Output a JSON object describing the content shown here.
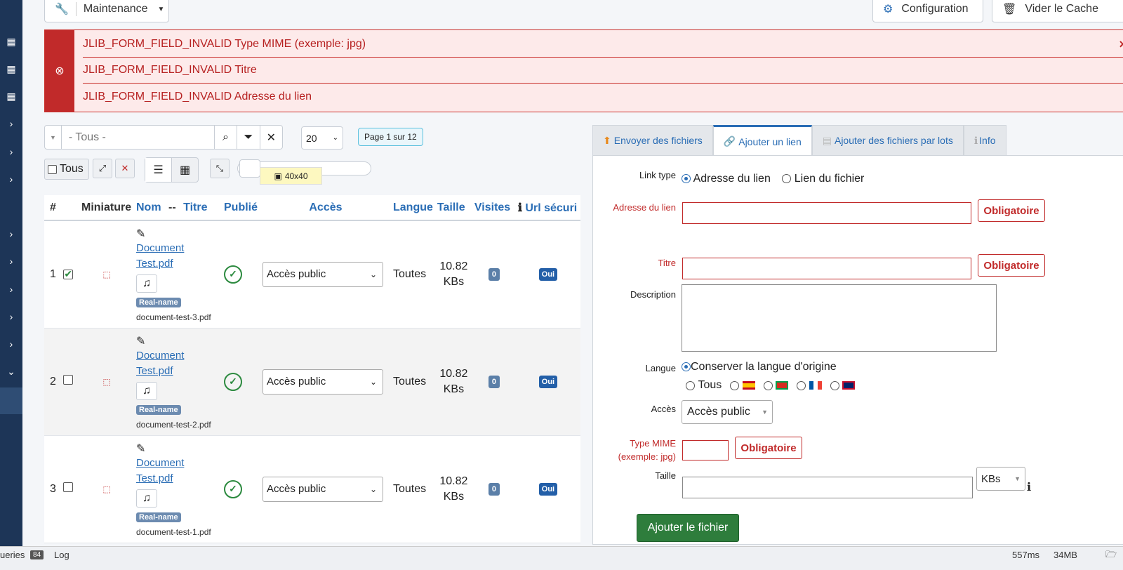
{
  "topbar": {
    "maintenance_label": "Maintenance",
    "configuration_label": "Configuration",
    "vider_label": "Vider le Cache"
  },
  "alert": {
    "messages": [
      "JLIB_FORM_FIELD_INVALID Type MIME (exemple: jpg)",
      "JLIB_FORM_FIELD_INVALID Titre",
      "JLIB_FORM_FIELD_INVALID Adresse du lien"
    ],
    "close": "×"
  },
  "filters": {
    "search_placeholder": "- Tous -",
    "limit": "20",
    "page_info": "Page 1 sur 12",
    "tous_label": "Tous",
    "thumb_size": "40x40"
  },
  "table": {
    "headers": {
      "num": "#",
      "miniature": "Miniature",
      "nom": "Nom",
      "sep": "--",
      "titre": "Titre",
      "publie": "Publié",
      "acces": "Accès",
      "langue": "Langue",
      "taille": "Taille",
      "visites": "Visites",
      "url": "Url sécurisée"
    },
    "rows": [
      {
        "num": "1",
        "title1": "Document",
        "title2": "Test.pdf",
        "tag": "Real-name",
        "file": "document-test-3.pdf",
        "access": "Accès public",
        "lang": "Toutes",
        "size1": "10.82",
        "size2": "KBs",
        "visits": "0",
        "url": "Oui"
      },
      {
        "num": "2",
        "title1": "Document",
        "title2": "Test.pdf",
        "tag": "Real-name",
        "file": "document-test-2.pdf",
        "access": "Accès public",
        "lang": "Toutes",
        "size1": "10.82",
        "size2": "KBs",
        "visits": "0",
        "url": "Oui"
      },
      {
        "num": "3",
        "title1": "Document",
        "title2": "Test.pdf",
        "tag": "Real-name",
        "file": "document-test-1.pdf",
        "access": "Accès public",
        "lang": "Toutes",
        "size1": "10.82",
        "size2": "KBs",
        "visits": "0",
        "url": "Oui"
      }
    ]
  },
  "tabs": [
    "Envoyer des fichiers",
    "Ajouter un lien",
    "Ajouter des fichiers par lots",
    "Info"
  ],
  "form": {
    "link_type_label": "Link type",
    "link_type_opt1": "Adresse du lien",
    "link_type_opt2": "Lien du fichier",
    "adresse_label": "Adresse du lien",
    "titre_label": "Titre",
    "description_label": "Description",
    "langue_label": "Langue",
    "langue_keep": "Conserver la langue d'origine",
    "langue_tous": "Tous",
    "acces_label": "Accès",
    "acces_value": "Accès public",
    "mime_label_1": "Type MIME",
    "mime_label_2": "(exemple: jpg)",
    "taille_label": "Taille",
    "unit": "KBs",
    "required": "Obligatoire",
    "submit": "Ajouter le fichier"
  },
  "status": {
    "queries_label": "ueries",
    "queries_count": "84",
    "log": "Log",
    "time": "557ms",
    "memory": "34MB"
  },
  "colors": {
    "sidebar": "#1d3557",
    "error": "#c12a2a",
    "link": "#2a6db5",
    "submit": "#2e7d3c"
  }
}
